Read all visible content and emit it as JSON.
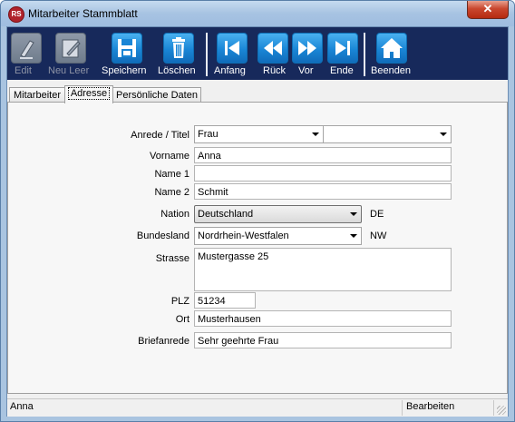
{
  "window": {
    "title": "Mitarbeiter Stammblatt",
    "close_glyph": "✕",
    "app_icon_text": "RS"
  },
  "toolbar": {
    "edit": "Edit",
    "new": "Neu Leer",
    "save": "Speichern",
    "delete": "Löschen",
    "first": "Anfang",
    "back": "Rück",
    "next": "Vor",
    "last": "Ende",
    "quit": "Beenden"
  },
  "tabs": {
    "employee": "Mitarbeiter",
    "address": "Adresse",
    "personal": "Persönliche Daten"
  },
  "form": {
    "salutation_label": "Anrede / Titel",
    "salutation_value": "Frau",
    "title_value": "",
    "firstname_label": "Vorname",
    "firstname_value": "Anna",
    "name1_label": "Name 1",
    "name1_value": "",
    "name2_label": "Name 2",
    "name2_value": "Schmit",
    "nation_label": "Nation",
    "nation_value": "Deutschland",
    "nation_code": "DE",
    "state_label": "Bundesland",
    "state_value": "Nordrhein-Westfalen",
    "state_code": "NW",
    "street_label": "Strasse",
    "street_value": "Mustergasse 25",
    "zip_label": "PLZ",
    "zip_value": "51234",
    "city_label": "Ort",
    "city_value": "Musterhausen",
    "letter_label": "Briefanrede",
    "letter_value": "Sehr geehrte Frau"
  },
  "status": {
    "left": "Anna",
    "mode": "Bearbeiten"
  },
  "colors": {
    "toolbar_bg": "#17295b",
    "icon_blue": "#1a86d6",
    "close_red": "#c9472e"
  }
}
